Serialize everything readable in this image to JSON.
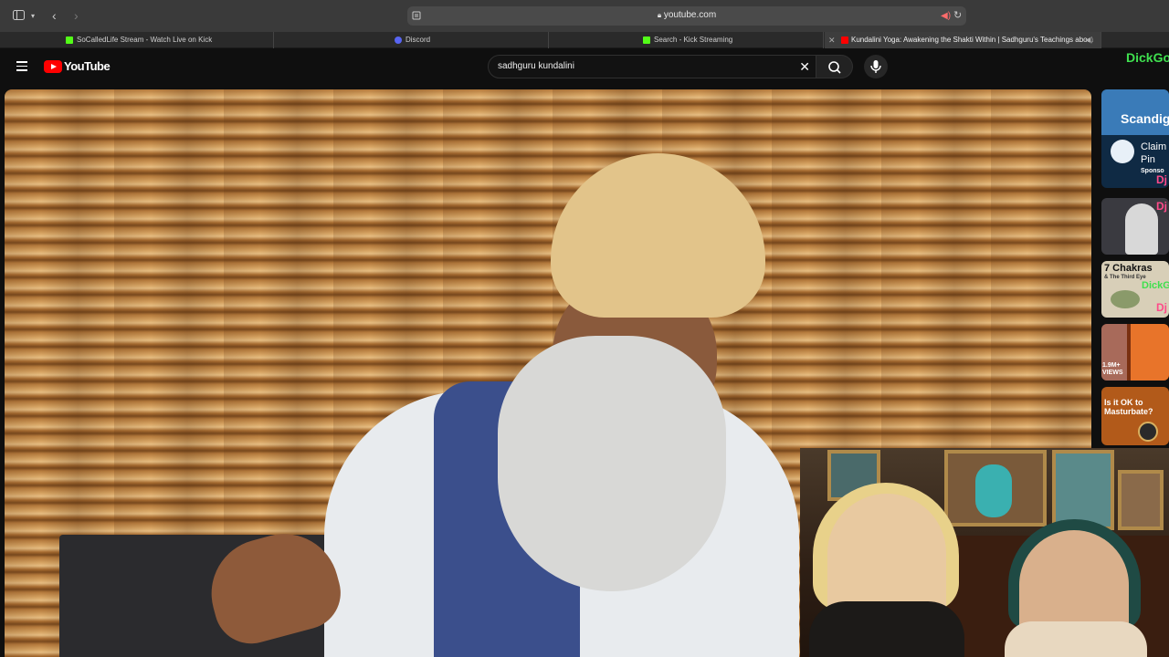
{
  "browser": {
    "url": "youtube.com",
    "tabs": [
      {
        "label": "SoCalledLife Stream - Watch Live on Kick",
        "favicon_color": "#53fc18"
      },
      {
        "label": "Discord",
        "favicon_color": "#5865f2"
      },
      {
        "label": "Search - Kick Streaming",
        "favicon_color": "#53fc18"
      },
      {
        "label": "Kundalini Yoga: Awakening the Shakti Within | Sadhguru's Teachings abo...",
        "favicon_color": "#ff0000",
        "active": true
      }
    ]
  },
  "youtube": {
    "logo_text": "YouTube",
    "search_value": "sadhguru kundalini",
    "overlay_text": "DickGo"
  },
  "sidebar": {
    "thumbs": [
      {
        "text": "Scandig",
        "sub1": "Claim",
        "sub2": "Pin",
        "sub3": "Sponso",
        "tag": "Dj"
      },
      {
        "text": "Dj"
      },
      {
        "text": "7 Chakras",
        "sub1": "& The Third Eye",
        "sub2": "DickGo",
        "tag": "Dj"
      },
      {
        "text": "1.9M+",
        "sub1": "VIEWS"
      },
      {
        "text": "Is it OK to",
        "sub1": "Masturbate?"
      }
    ]
  },
  "colors": {
    "accent_green": "#3fe04f",
    "youtube_red": "#ff0000"
  }
}
